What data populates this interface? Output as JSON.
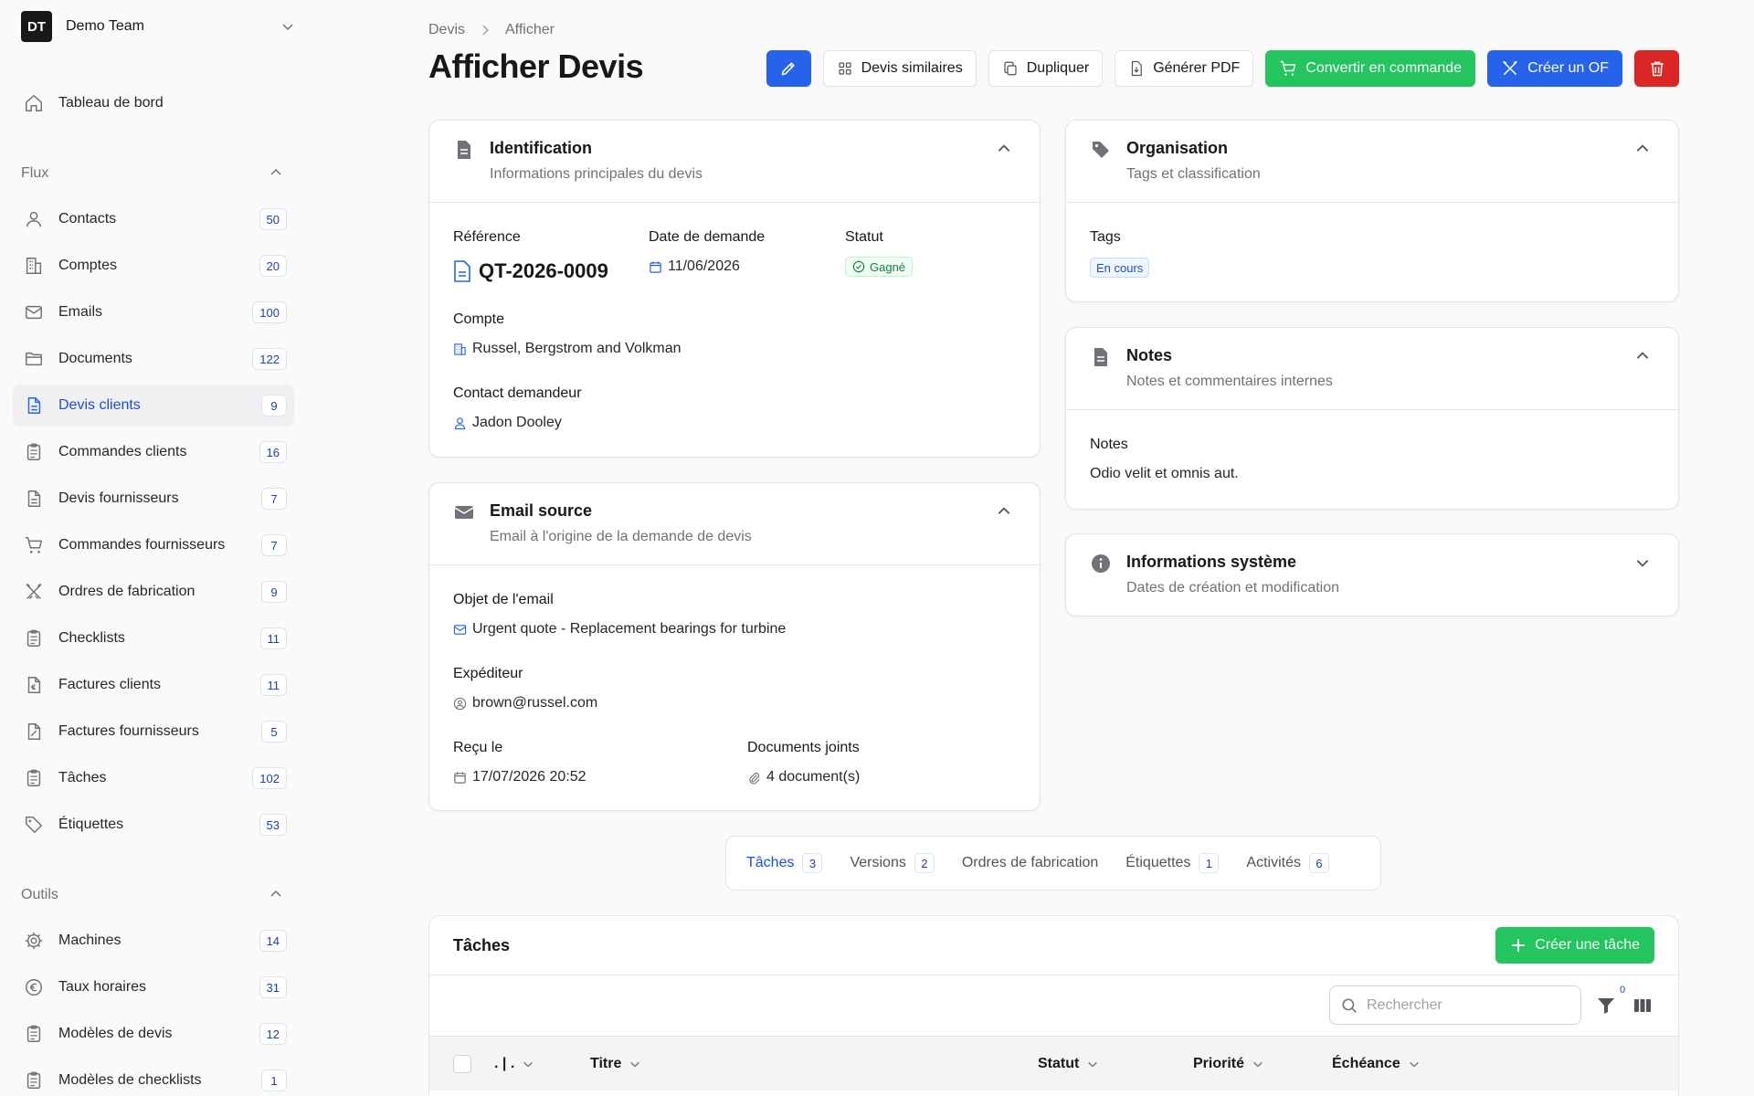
{
  "team": {
    "initials": "DT",
    "name": "Demo Team"
  },
  "sidebar": {
    "dashboard": "Tableau de bord",
    "flux_label": "Flux",
    "flux_items": [
      {
        "label": "Contacts",
        "count": "50",
        "icon": "user-icon"
      },
      {
        "label": "Comptes",
        "count": "20",
        "icon": "building-icon"
      },
      {
        "label": "Emails",
        "count": "100",
        "icon": "mail-icon"
      },
      {
        "label": "Documents",
        "count": "122",
        "icon": "folder-icon"
      },
      {
        "label": "Devis clients",
        "count": "9",
        "icon": "document-icon",
        "active": true
      },
      {
        "label": "Commandes clients",
        "count": "16",
        "icon": "clipboard-icon"
      },
      {
        "label": "Devis fournisseurs",
        "count": "7",
        "icon": "document-icon"
      },
      {
        "label": "Commandes fournisseurs",
        "count": "7",
        "icon": "cart-icon"
      },
      {
        "label": "Ordres de fabrication",
        "count": "9",
        "icon": "tools-icon"
      },
      {
        "label": "Checklists",
        "count": "11",
        "icon": "clipboard-icon"
      },
      {
        "label": "Factures clients",
        "count": "11",
        "icon": "invoice-icon"
      },
      {
        "label": "Factures fournisseurs",
        "count": "5",
        "icon": "receipt-icon"
      },
      {
        "label": "Tâches",
        "count": "102",
        "icon": "clipboard-icon"
      },
      {
        "label": "Étiquettes",
        "count": "53",
        "icon": "tag-icon"
      }
    ],
    "outils_label": "Outils",
    "outils_items": [
      {
        "label": "Machines",
        "count": "14",
        "icon": "gear-icon"
      },
      {
        "label": "Taux horaires",
        "count": "31",
        "icon": "euro-icon"
      },
      {
        "label": "Modèles de devis",
        "count": "12",
        "icon": "clipboard-icon"
      },
      {
        "label": "Modèles de checklists",
        "count": "1",
        "icon": "clipboard-icon"
      }
    ]
  },
  "breadcrumb": {
    "parent": "Devis",
    "current": "Afficher"
  },
  "page_title": "Afficher Devis",
  "actions": {
    "similar": "Devis similaires",
    "duplicate": "Dupliquer",
    "pdf": "Générer PDF",
    "convert": "Convertir en commande",
    "create_of": "Créer un OF"
  },
  "identification": {
    "title": "Identification",
    "subtitle": "Informations principales du devis",
    "reference_label": "Référence",
    "reference": "QT-2026-0009",
    "date_label": "Date de demande",
    "date": "11/06/2026",
    "status_label": "Statut",
    "status": "Gagné",
    "account_label": "Compte",
    "account": "Russel, Bergstrom and Volkman",
    "contact_label": "Contact demandeur",
    "contact": "Jadon Dooley"
  },
  "email_source": {
    "title": "Email source",
    "subtitle": "Email à l'origine de la demande de devis",
    "subject_label": "Objet de l'email",
    "subject": "Urgent quote - Replacement bearings for turbine",
    "sender_label": "Expéditeur",
    "sender": "brown@russel.com",
    "received_label": "Reçu le",
    "received": "17/07/2026 20:52",
    "attachments_label": "Documents joints",
    "attachments": "4 document(s)"
  },
  "organisation": {
    "title": "Organisation",
    "subtitle": "Tags et classification",
    "tags_label": "Tags",
    "tag": "En cours"
  },
  "notes": {
    "title": "Notes",
    "subtitle": "Notes et commentaires internes",
    "notes_label": "Notes",
    "notes_value": "Odio velit et omnis aut."
  },
  "system": {
    "title": "Informations système",
    "subtitle": "Dates de création et modification"
  },
  "tabs": [
    {
      "label": "Tâches",
      "count": "3",
      "active": true
    },
    {
      "label": "Versions",
      "count": "2"
    },
    {
      "label": "Ordres de fabrication",
      "count": ""
    },
    {
      "label": "Étiquettes",
      "count": "1"
    },
    {
      "label": "Activités",
      "count": "6"
    }
  ],
  "tasks": {
    "title": "Tâches",
    "create": "Créer une tâche",
    "search_placeholder": "Rechercher",
    "filter_count": "0",
    "columns": [
      ". | .",
      "Titre",
      "Statut",
      "Priorité",
      "Échéance"
    ]
  },
  "colors": {
    "primary": "#2563eb",
    "success": "#22c55e",
    "danger": "#dc2626",
    "active_text": "#1d4ed8"
  }
}
